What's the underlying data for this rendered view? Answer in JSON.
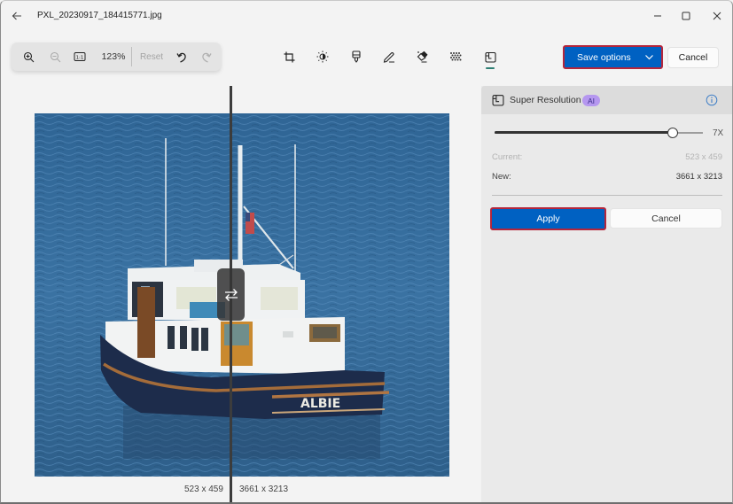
{
  "window": {
    "title": "PXL_20230917_184415771.jpg",
    "icons": {
      "back": "arrow-left-icon",
      "minimize": "minimize-icon",
      "maximize": "maximize-icon",
      "close": "close-icon"
    }
  },
  "zoom_toolbar": {
    "zoom_in_icon": "zoom-in-icon",
    "zoom_out_icon": "zoom-out-icon",
    "zoom_out_disabled": true,
    "actual_size_icon": "actual-size-icon",
    "actual_size_label": "1:1",
    "zoom_level": "123%",
    "reset_label": "Reset",
    "reset_disabled": true,
    "undo_icon": "undo-icon",
    "redo_icon": "redo-icon",
    "redo_disabled": true
  },
  "edit_tools": [
    {
      "name": "crop",
      "icon": "crop-icon"
    },
    {
      "name": "adjustment",
      "icon": "brightness-icon"
    },
    {
      "name": "filter",
      "icon": "filter-icon"
    },
    {
      "name": "markup",
      "icon": "pen-icon"
    },
    {
      "name": "erase",
      "icon": "eraser-icon"
    },
    {
      "name": "background-blur",
      "icon": "blur-icon"
    },
    {
      "name": "super-resolution",
      "icon": "super-resolution-icon",
      "active": true
    }
  ],
  "actions": {
    "save_options_label": "Save options",
    "cancel_label": "Cancel"
  },
  "canvas": {
    "compare_handle_icon": "swap-arrows-icon",
    "original_size": "523 x 459",
    "new_size": "3661 x 3213",
    "boat_name": "ALBIE"
  },
  "panel": {
    "title": "Super Resolution",
    "badge": "AI",
    "info_icon": "info-icon",
    "slider": {
      "min": 1,
      "max": 8,
      "value": 7,
      "value_label": "7X"
    },
    "current_label": "Current:",
    "current_value": "523 x 459",
    "new_label": "New:",
    "new_value": "3661 x 3213",
    "apply_label": "Apply",
    "cancel_label": "Cancel"
  },
  "colors": {
    "accent": "#0061c2",
    "highlight_border": "#b3263c",
    "ai_badge": "#b597ef",
    "active_tool_indicator": "#2f7f74"
  }
}
